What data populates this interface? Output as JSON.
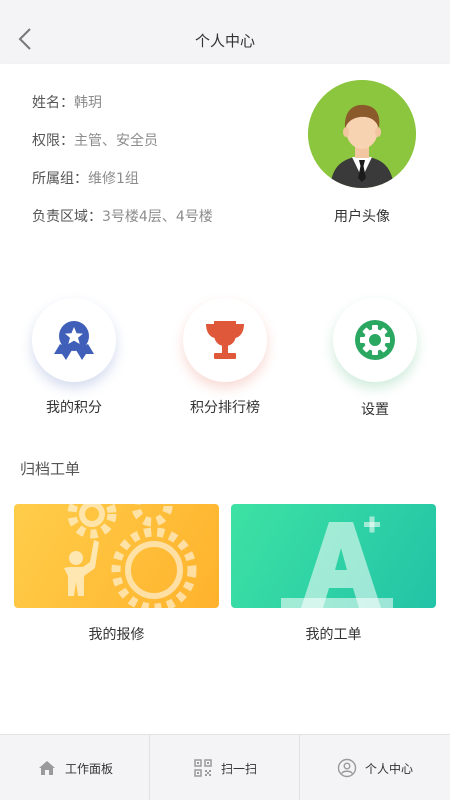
{
  "header": {
    "title": "个人中心"
  },
  "profile": {
    "fields": [
      {
        "label": "姓名：",
        "value": "韩玥"
      },
      {
        "label": "权限：",
        "value": "主管、安全员"
      },
      {
        "label": "所属组：",
        "value": "维修1组"
      },
      {
        "label": "负责区域：",
        "value": "3号楼4层、4号楼"
      }
    ],
    "avatar_label": "用户头像"
  },
  "quick_actions": [
    {
      "label": "我的积分",
      "icon": "medal-icon",
      "color": "#3f5fb8"
    },
    {
      "label": "积分排行榜",
      "icon": "trophy-icon",
      "color": "#e0583a"
    },
    {
      "label": "设置",
      "icon": "gear-icon",
      "color": "#2aa761"
    }
  ],
  "archive": {
    "title": "归档工单",
    "cards": [
      {
        "label": "我的报修",
        "icon": "repair-gears-icon",
        "color": "#ffb93a"
      },
      {
        "label": "我的工单",
        "icon": "letter-a-plus-icon",
        "color": "#2ed5a3"
      }
    ]
  },
  "tabbar": [
    {
      "label": "工作面板",
      "icon": "home-icon"
    },
    {
      "label": "扫一扫",
      "icon": "qr-scan-icon"
    },
    {
      "label": "个人中心",
      "icon": "user-icon"
    }
  ]
}
